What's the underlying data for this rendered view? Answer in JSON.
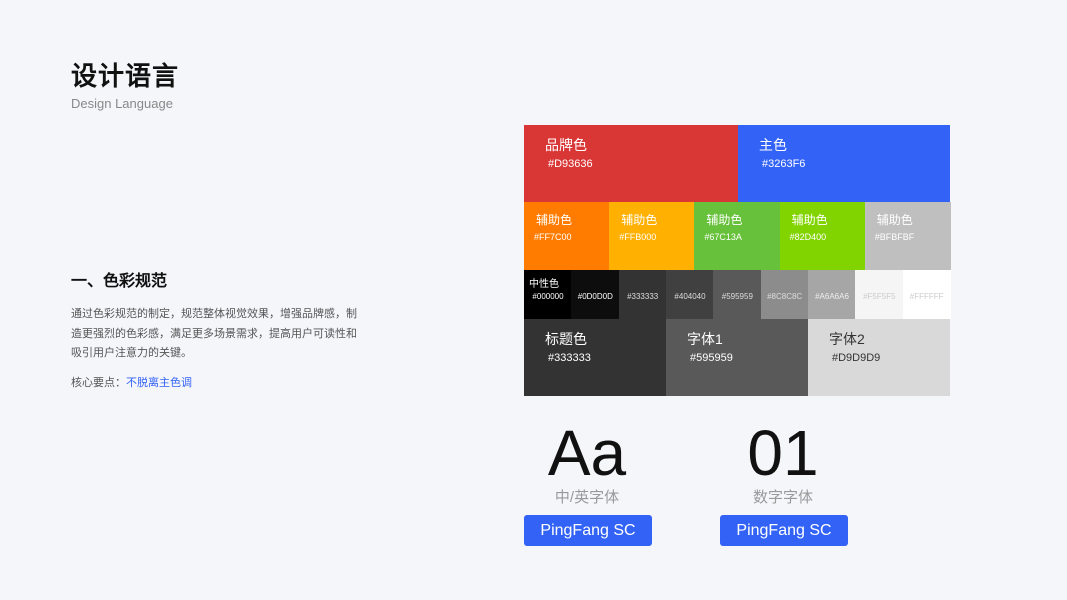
{
  "header": {
    "title": "设计语言",
    "subtitle": "Design Language"
  },
  "section": {
    "title": "一、色彩规范",
    "description": "通过色彩规范的制定，规范整体视觉效果，增强品牌感，制造更强烈的色彩感，满足更多场景需求，提高用户可读性和吸引用户注意力的关键。",
    "key_label": "核心要点：",
    "key_value": "不脱离主色调"
  },
  "palette": {
    "brand": {
      "name": "品牌色",
      "hex": "#D93636",
      "color": "#D93636"
    },
    "primary": {
      "name": "主色",
      "hex": "#3263F6",
      "color": "#3263F6"
    },
    "auxiliary": [
      {
        "name": "辅助色",
        "hex": "#FF7C00",
        "color": "#FF7C00"
      },
      {
        "name": "辅助色",
        "hex": "#FFB000",
        "color": "#FFB000"
      },
      {
        "name": "辅助色",
        "hex": "#67C13A",
        "color": "#67C13A"
      },
      {
        "name": "辅助色",
        "hex": "#82D400",
        "color": "#82D400"
      },
      {
        "name": "辅助色",
        "hex": "#BFBFBF",
        "color": "#BFBFBF"
      }
    ],
    "neutral_label": "中性色",
    "neutral": [
      {
        "hex": "#000000",
        "color": "#000000",
        "text_color": "#ffffff"
      },
      {
        "hex": "#0D0D0D",
        "color": "#0D0D0D",
        "text_color": "#ffffff"
      },
      {
        "hex": "#333333",
        "color": "#333333",
        "text_color": "#dddddd"
      },
      {
        "hex": "#404040",
        "color": "#404040",
        "text_color": "#dddddd"
      },
      {
        "hex": "#595959",
        "color": "#595959",
        "text_color": "#dddddd"
      },
      {
        "hex": "#8C8C8C",
        "color": "#8C8C8C",
        "text_color": "#dddddd"
      },
      {
        "hex": "#A6A6A6",
        "color": "#A6A6A6",
        "text_color": "#eeeeee"
      },
      {
        "hex": "#F5F5F5",
        "color": "#F5F5F5",
        "text_color": "#cccccc"
      },
      {
        "hex": "#FFFFFF",
        "color": "#FFFFFF",
        "text_color": "#cccccc"
      }
    ],
    "text_colors": [
      {
        "name": "标题色",
        "hex": "#333333",
        "color": "#333333",
        "text_color": "#ffffff"
      },
      {
        "name": "字体1",
        "hex": "#595959",
        "color": "#595959",
        "text_color": "#ffffff"
      },
      {
        "name": "字体2",
        "hex": "#D9D9D9",
        "color": "#D9D9D9",
        "text_color": "#333333"
      }
    ]
  },
  "typography": [
    {
      "sample": "Aa",
      "label": "中/英字体",
      "font_name": "PingFang SC"
    },
    {
      "sample": "01",
      "label": "数字字体",
      "font_name": "PingFang SC"
    }
  ]
}
